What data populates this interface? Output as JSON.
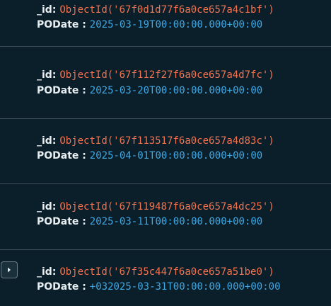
{
  "documents": [
    {
      "id_key": "_id",
      "id_value": "ObjectId('67f0d1d77f6a0ce657a4c1bf')",
      "date_key": "PODate",
      "date_value": "2025-03-19T00:00:00.000+00:00"
    },
    {
      "id_key": "_id",
      "id_value": "ObjectId('67f112f27f6a0ce657a4d7fc')",
      "date_key": "PODate",
      "date_value": "2025-03-20T00:00:00.000+00:00"
    },
    {
      "id_key": "_id",
      "id_value": "ObjectId('67f113517f6a0ce657a4d83c')",
      "date_key": "PODate",
      "date_value": "2025-04-01T00:00:00.000+00:00"
    },
    {
      "id_key": "_id",
      "id_value": "ObjectId('67f119487f6a0ce657a4dc25')",
      "date_key": "PODate",
      "date_value": "2025-03-11T00:00:00.000+00:00"
    },
    {
      "id_key": "_id",
      "id_value": "ObjectId('67f35c447f6a0ce657a51be0')",
      "date_key": "PODate",
      "date_value": "+032025-03-31T00:00:00.000+00:00"
    }
  ],
  "colors": {
    "background": "#0b1f2a",
    "key": "#e8edf0",
    "object_id": "#f2734f",
    "date": "#3fa9e6",
    "divider": "#3d4f59"
  },
  "icons": {
    "expand": "chevron-right-icon"
  }
}
